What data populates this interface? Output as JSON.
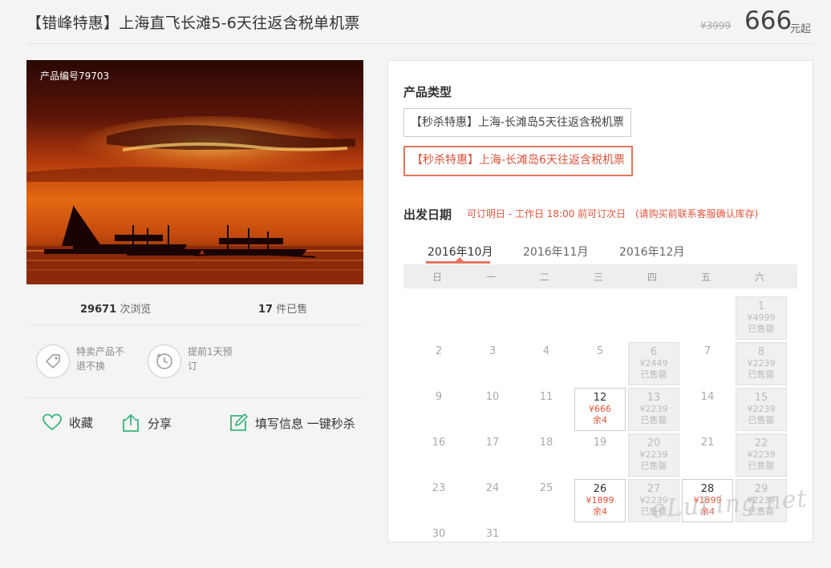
{
  "header": {
    "title": "【错峰特惠】上海直飞长滩5-6天往返含税单机票",
    "old_price": "¥3999",
    "price": "666",
    "price_unit": "元起"
  },
  "product": {
    "number_label": "产品编号79703",
    "views_count": "29671",
    "views_label": "次浏览",
    "sold_count": "17",
    "sold_label": "件已售"
  },
  "features": [
    {
      "icon": "tag-icon",
      "text": "特卖产品不退不换"
    },
    {
      "icon": "clock-icon",
      "text": "提前1天预订"
    }
  ],
  "actions": {
    "favorite": "收藏",
    "share": "分享",
    "book": "填写信息 一键秒杀"
  },
  "panel": {
    "product_type_label": "产品类型",
    "options": [
      "【秒杀特惠】上海-长滩岛5天往返含税机票",
      "【秒杀特惠】上海-长滩岛6天往返含税机票"
    ],
    "selected_option": 1,
    "departure_label": "出发日期",
    "note1": "可订明日 - 工作日 18:00 前可订次日",
    "note2": "(请购买前联系客服确认库存)",
    "months": [
      "2016年10月",
      "2016年11月",
      "2016年12月"
    ],
    "active_month": 0,
    "weekdays": [
      "日",
      "一",
      "二",
      "三",
      "四",
      "五",
      "六"
    ],
    "days": [
      {
        "d": "1",
        "col": 6,
        "row": 0,
        "status": "sold",
        "price": "¥4999",
        "info": "已售罄"
      },
      {
        "d": "2",
        "col": 0,
        "row": 1
      },
      {
        "d": "3",
        "col": 1,
        "row": 1
      },
      {
        "d": "4",
        "col": 2,
        "row": 1
      },
      {
        "d": "5",
        "col": 3,
        "row": 1
      },
      {
        "d": "6",
        "col": 4,
        "row": 1,
        "status": "sold",
        "price": "¥2449",
        "info": "已售罄"
      },
      {
        "d": "7",
        "col": 5,
        "row": 1
      },
      {
        "d": "8",
        "col": 6,
        "row": 1,
        "status": "sold",
        "price": "¥2239",
        "info": "已售罄"
      },
      {
        "d": "9",
        "col": 0,
        "row": 2
      },
      {
        "d": "10",
        "col": 1,
        "row": 2
      },
      {
        "d": "11",
        "col": 2,
        "row": 2
      },
      {
        "d": "12",
        "col": 3,
        "row": 2,
        "status": "avail",
        "price": "¥666",
        "info": "余4"
      },
      {
        "d": "13",
        "col": 4,
        "row": 2,
        "status": "sold",
        "price": "¥2239",
        "info": "已售罄"
      },
      {
        "d": "14",
        "col": 5,
        "row": 2
      },
      {
        "d": "15",
        "col": 6,
        "row": 2,
        "status": "sold",
        "price": "¥2239",
        "info": "已售罄"
      },
      {
        "d": "16",
        "col": 0,
        "row": 3
      },
      {
        "d": "17",
        "col": 1,
        "row": 3
      },
      {
        "d": "18",
        "col": 2,
        "row": 3
      },
      {
        "d": "19",
        "col": 3,
        "row": 3
      },
      {
        "d": "20",
        "col": 4,
        "row": 3,
        "status": "sold",
        "price": "¥2239",
        "info": "已售罄"
      },
      {
        "d": "21",
        "col": 5,
        "row": 3
      },
      {
        "d": "22",
        "col": 6,
        "row": 3,
        "status": "sold",
        "price": "¥2239",
        "info": "已售罄"
      },
      {
        "d": "23",
        "col": 0,
        "row": 4
      },
      {
        "d": "24",
        "col": 1,
        "row": 4
      },
      {
        "d": "25",
        "col": 2,
        "row": 4
      },
      {
        "d": "26",
        "col": 3,
        "row": 4,
        "status": "avail",
        "price": "¥1899",
        "info": "余4"
      },
      {
        "d": "27",
        "col": 4,
        "row": 4,
        "status": "sold",
        "price": "¥2239",
        "info": "已售罄"
      },
      {
        "d": "28",
        "col": 5,
        "row": 4,
        "status": "avail",
        "price": "¥1899",
        "info": "余4"
      },
      {
        "d": "29",
        "col": 6,
        "row": 4,
        "status": "sold",
        "price": "¥2239",
        "info": "已售罄"
      },
      {
        "d": "30",
        "col": 0,
        "row": 5
      },
      {
        "d": "31",
        "col": 1,
        "row": 5
      }
    ]
  },
  "watermark": "eLuLing.net",
  "colors": {
    "accent": "#e3765f",
    "accent_text": "#e0543c",
    "green_icon": "#3bb47a",
    "panel_bg": "#ffffff",
    "page_bg": "#f4f4f4"
  }
}
